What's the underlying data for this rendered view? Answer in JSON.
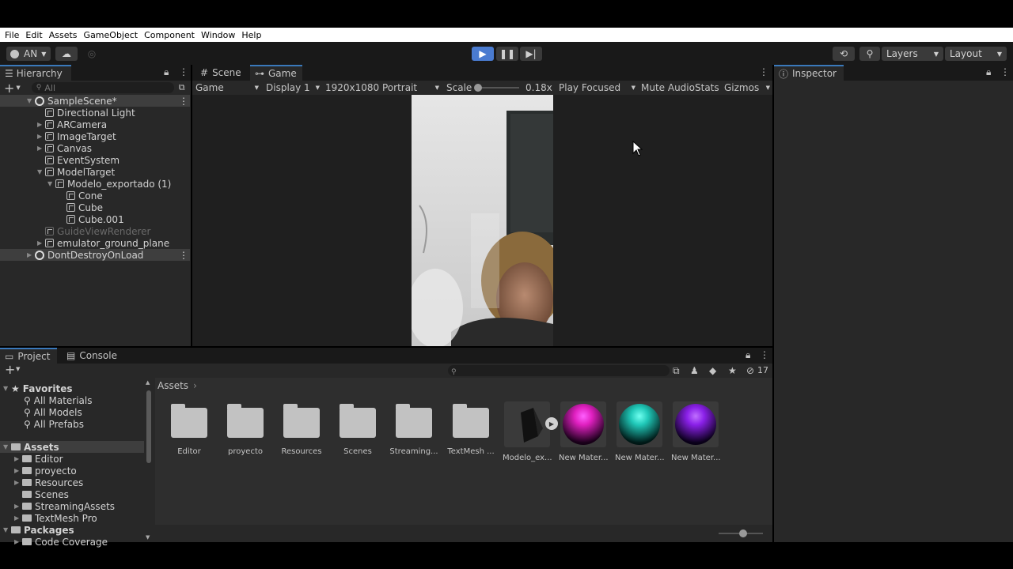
{
  "menu": [
    "File",
    "Edit",
    "Assets",
    "GameObject",
    "Component",
    "Window",
    "Help"
  ],
  "toolbar": {
    "account": "AN",
    "layers": "Layers",
    "layout": "Layout"
  },
  "hierarchy": {
    "tab": "Hierarchy",
    "search_placeholder": "All",
    "items": [
      {
        "label": "SampleScene*",
        "indent": 0
      },
      {
        "label": "Directional Light",
        "indent": 1
      },
      {
        "label": "ARCamera",
        "indent": 1
      },
      {
        "label": "ImageTarget",
        "indent": 1
      },
      {
        "label": "Canvas",
        "indent": 1
      },
      {
        "label": "EventSystem",
        "indent": 1
      },
      {
        "label": "ModelTarget",
        "indent": 1
      },
      {
        "label": "Modelo_exportado (1)",
        "indent": 2
      },
      {
        "label": "Cone",
        "indent": 3
      },
      {
        "label": "Cube",
        "indent": 3
      },
      {
        "label": "Cube.001",
        "indent": 3
      },
      {
        "label": "GuideViewRenderer",
        "indent": 1
      },
      {
        "label": "emulator_ground_plane",
        "indent": 1
      },
      {
        "label": "DontDestroyOnLoad",
        "indent": 0
      }
    ]
  },
  "scene_tabs": {
    "scene": "Scene",
    "game": "Game"
  },
  "game_bar": {
    "game": "Game",
    "display": "Display 1",
    "resolution": "1920x1080 Portrait",
    "scale_label": "Scale",
    "scale_value": "0.18x",
    "play_focused": "Play Focused",
    "mute": "Mute Audio",
    "stats": "Stats",
    "gizmos": "Gizmos"
  },
  "inspector": {
    "tab": "Inspector"
  },
  "project": {
    "tab_project": "Project",
    "tab_console": "Console",
    "hidden_count": "17",
    "breadcrumb": "Assets",
    "favorites": {
      "title": "Favorites",
      "items": [
        "All Materials",
        "All Models",
        "All Prefabs"
      ]
    },
    "assets_tree": {
      "title": "Assets",
      "items": [
        "Editor",
        "proyecto",
        "Resources",
        "Scenes",
        "StreamingAssets",
        "TextMesh Pro"
      ]
    },
    "packages": {
      "title": "Packages",
      "items": [
        "Code Coverage"
      ]
    },
    "grid": [
      {
        "label": "Editor",
        "kind": "folder"
      },
      {
        "label": "proyecto",
        "kind": "folder"
      },
      {
        "label": "Resources",
        "kind": "folder"
      },
      {
        "label": "Scenes",
        "kind": "folder"
      },
      {
        "label": "Streaming...",
        "kind": "folder"
      },
      {
        "label": "TextMesh ...",
        "kind": "folder"
      },
      {
        "label": "Modelo_ex...",
        "kind": "model"
      },
      {
        "label": "New Mater...",
        "kind": "material",
        "color": "#e020c0"
      },
      {
        "label": "New Mater...",
        "kind": "material",
        "color": "#20c8b8"
      },
      {
        "label": "New Mater...",
        "kind": "material",
        "color": "#8a20e8"
      }
    ]
  },
  "colors": {
    "accent": "#3a79bb",
    "play_active": "#4a7bd0"
  }
}
